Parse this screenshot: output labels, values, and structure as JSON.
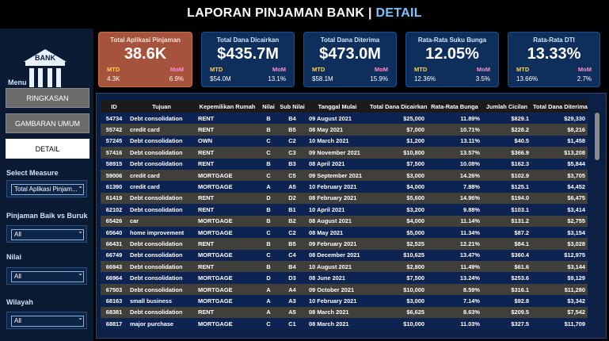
{
  "header": {
    "title_main": "LAPORAN PINJAMAN BANK | ",
    "title_accent": "DETAIL"
  },
  "sidebar": {
    "logo_text": "BANK",
    "menu_label": "Menu",
    "nav": [
      {
        "label": "RINGKASAN"
      },
      {
        "label": "GAMBARAN UMUM"
      },
      {
        "label": "DETAIL"
      }
    ],
    "filters": [
      {
        "label": "Select Measure",
        "value": "Total Aplikasi Pinjam..."
      },
      {
        "label": "Pinjaman Baik vs Buruk",
        "value": "All"
      },
      {
        "label": "Nilai",
        "value": "All"
      },
      {
        "label": "Wilayah",
        "value": "All"
      }
    ]
  },
  "cards": [
    {
      "title": "Total Aplikasi Pinjaman",
      "value": "38.6K",
      "mtd_label": "MTD",
      "mom_label": "MoM",
      "mtd": "4.3K",
      "mom": "6.9%",
      "highlight": true
    },
    {
      "title": "Total Dana Dicairkan",
      "value": "$435.7M",
      "mtd_label": "MTD",
      "mom_label": "MoM",
      "mtd": "$54.0M",
      "mom": "13.1%"
    },
    {
      "title": "Total Dana Diterima",
      "value": "$473.0M",
      "mtd_label": "MTD",
      "mom_label": "MoM",
      "mtd": "$58.1M",
      "mom": "15.9%"
    },
    {
      "title": "Rata-Rata Suku Bunga",
      "value": "12.05%",
      "mtd_label": "MTD",
      "mom_label": "MoM",
      "mtd": "12.36%",
      "mom": "3.5%"
    },
    {
      "title": "Rata-Rata DTI",
      "value": "13.33%",
      "mtd_label": "MTD",
      "mom_label": "MoM",
      "mtd": "13.66%",
      "mom": "2.7%"
    }
  ],
  "table": {
    "columns": [
      "ID",
      "Tujuan",
      "Kepemilikan Rumah",
      "Nilai",
      "Sub Nilai",
      "Tanggal Mulai",
      "Total Dana Dicairkan",
      "Rata-Rata Bunga",
      "Jumlah Cicilan",
      "Total Dana Diterima"
    ],
    "rows": [
      [
        "54734",
        "Debt consolidation",
        "RENT",
        "B",
        "B4",
        "09 August 2021",
        "$25,000",
        "11.89%",
        "$829.1",
        "$29,330"
      ],
      [
        "55742",
        "credit card",
        "RENT",
        "B",
        "B5",
        "08 May 2021",
        "$7,000",
        "10.71%",
        "$228.2",
        "$8,216"
      ],
      [
        "57245",
        "Debt consolidation",
        "OWN",
        "C",
        "C2",
        "10 March 2021",
        "$1,200",
        "13.11%",
        "$40.5",
        "$1,458"
      ],
      [
        "57416",
        "Debt consolidation",
        "RENT",
        "C",
        "C3",
        "09 November 2021",
        "$10,800",
        "13.57%",
        "$366.9",
        "$13,208"
      ],
      [
        "58915",
        "Debt consolidation",
        "RENT",
        "B",
        "B3",
        "08 April 2021",
        "$7,500",
        "10.08%",
        "$162.3",
        "$5,844"
      ],
      [
        "59006",
        "credit card",
        "MORTGAGE",
        "C",
        "C5",
        "09 September 2021",
        "$3,000",
        "14.26%",
        "$102.9",
        "$3,705"
      ],
      [
        "61390",
        "credit card",
        "MORTGAGE",
        "A",
        "A5",
        "10 February 2021",
        "$4,000",
        "7.88%",
        "$125.1",
        "$4,452"
      ],
      [
        "61419",
        "Debt consolidation",
        "RENT",
        "D",
        "D2",
        "08 February 2021",
        "$5,600",
        "14.96%",
        "$194.0",
        "$6,475"
      ],
      [
        "62102",
        "Debt consolidation",
        "RENT",
        "B",
        "B1",
        "10 April 2021",
        "$3,200",
        "9.88%",
        "$103.1",
        "$3,414"
      ],
      [
        "65426",
        "car",
        "MORTGAGE",
        "B",
        "B2",
        "08 August 2021",
        "$4,000",
        "11.14%",
        "$131.2",
        "$2,755"
      ],
      [
        "65640",
        "home improvement",
        "MORTGAGE",
        "C",
        "C2",
        "08 May 2021",
        "$5,000",
        "11.34%",
        "$87.2",
        "$3,154"
      ],
      [
        "66431",
        "Debt consolidation",
        "RENT",
        "B",
        "B5",
        "09 February 2021",
        "$2,525",
        "12.21%",
        "$84.1",
        "$3,028"
      ],
      [
        "66749",
        "Debt consolidation",
        "MORTGAGE",
        "C",
        "C4",
        "08 December 2021",
        "$10,625",
        "13.47%",
        "$360.4",
        "$12,975"
      ],
      [
        "66943",
        "Debt consolidation",
        "RENT",
        "B",
        "B4",
        "10 August 2021",
        "$2,800",
        "11.49%",
        "$61.6",
        "$3,144"
      ],
      [
        "66964",
        "Debt consolidation",
        "MORTGAGE",
        "D",
        "D3",
        "08 June 2021",
        "$7,500",
        "13.24%",
        "$253.6",
        "$9,129"
      ],
      [
        "67503",
        "Debt consolidation",
        "MORTGAGE",
        "A",
        "A4",
        "09 October 2021",
        "$10,000",
        "8.59%",
        "$316.1",
        "$11,280"
      ],
      [
        "68163",
        "small business",
        "MORTGAGE",
        "A",
        "A3",
        "10 February 2021",
        "$3,000",
        "7.14%",
        "$92.8",
        "$3,342"
      ],
      [
        "68381",
        "Debt consolidation",
        "RENT",
        "A",
        "A5",
        "08 March 2021",
        "$6,625",
        "8.63%",
        "$209.5",
        "$7,542"
      ],
      [
        "68817",
        "major purchase",
        "MORTGAGE",
        "C",
        "C1",
        "08 March 2021",
        "$10,000",
        "11.03%",
        "$327.5",
        "$11,709"
      ]
    ]
  }
}
